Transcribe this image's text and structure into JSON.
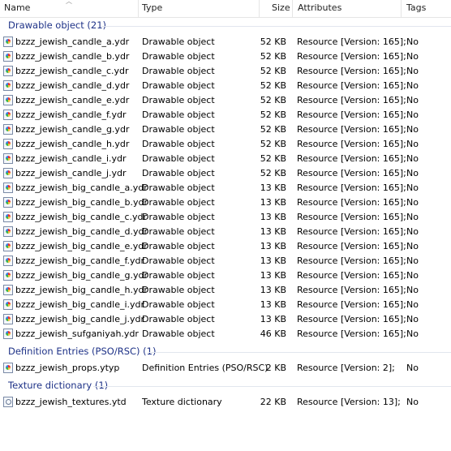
{
  "columns": {
    "name": "Name",
    "type": "Type",
    "size": "Size",
    "attributes": "Attributes",
    "tags": "Tags"
  },
  "groups": [
    {
      "label": "Drawable object (21)"
    },
    {
      "label": "Definition Entries (PSO/RSC) (1)"
    },
    {
      "label": "Texture dictionary (1)"
    }
  ],
  "files": [
    {
      "name": "bzzz_jewish_candle_a.ydr",
      "type": "Drawable object",
      "size": "52 KB",
      "attributes": "Resource [Version: 165];",
      "tags": "No"
    },
    {
      "name": "bzzz_jewish_candle_b.ydr",
      "type": "Drawable object",
      "size": "52 KB",
      "attributes": "Resource [Version: 165];",
      "tags": "No"
    },
    {
      "name": "bzzz_jewish_candle_c.ydr",
      "type": "Drawable object",
      "size": "52 KB",
      "attributes": "Resource [Version: 165];",
      "tags": "No"
    },
    {
      "name": "bzzz_jewish_candle_d.ydr",
      "type": "Drawable object",
      "size": "52 KB",
      "attributes": "Resource [Version: 165];",
      "tags": "No"
    },
    {
      "name": "bzzz_jewish_candle_e.ydr",
      "type": "Drawable object",
      "size": "52 KB",
      "attributes": "Resource [Version: 165];",
      "tags": "No"
    },
    {
      "name": "bzzz_jewish_candle_f.ydr",
      "type": "Drawable object",
      "size": "52 KB",
      "attributes": "Resource [Version: 165];",
      "tags": "No"
    },
    {
      "name": "bzzz_jewish_candle_g.ydr",
      "type": "Drawable object",
      "size": "52 KB",
      "attributes": "Resource [Version: 165];",
      "tags": "No"
    },
    {
      "name": "bzzz_jewish_candle_h.ydr",
      "type": "Drawable object",
      "size": "52 KB",
      "attributes": "Resource [Version: 165];",
      "tags": "No"
    },
    {
      "name": "bzzz_jewish_candle_i.ydr",
      "type": "Drawable object",
      "size": "52 KB",
      "attributes": "Resource [Version: 165];",
      "tags": "No"
    },
    {
      "name": "bzzz_jewish_candle_j.ydr",
      "type": "Drawable object",
      "size": "52 KB",
      "attributes": "Resource [Version: 165];",
      "tags": "No"
    },
    {
      "name": "bzzz_jewish_big_candle_a.ydr",
      "type": "Drawable object",
      "size": "13 KB",
      "attributes": "Resource [Version: 165];",
      "tags": "No"
    },
    {
      "name": "bzzz_jewish_big_candle_b.ydr",
      "type": "Drawable object",
      "size": "13 KB",
      "attributes": "Resource [Version: 165];",
      "tags": "No"
    },
    {
      "name": "bzzz_jewish_big_candle_c.ydr",
      "type": "Drawable object",
      "size": "13 KB",
      "attributes": "Resource [Version: 165];",
      "tags": "No"
    },
    {
      "name": "bzzz_jewish_big_candle_d.ydr",
      "type": "Drawable object",
      "size": "13 KB",
      "attributes": "Resource [Version: 165];",
      "tags": "No"
    },
    {
      "name": "bzzz_jewish_big_candle_e.ydr",
      "type": "Drawable object",
      "size": "13 KB",
      "attributes": "Resource [Version: 165];",
      "tags": "No"
    },
    {
      "name": "bzzz_jewish_big_candle_f.ydr",
      "type": "Drawable object",
      "size": "13 KB",
      "attributes": "Resource [Version: 165];",
      "tags": "No"
    },
    {
      "name": "bzzz_jewish_big_candle_g.ydr",
      "type": "Drawable object",
      "size": "13 KB",
      "attributes": "Resource [Version: 165];",
      "tags": "No"
    },
    {
      "name": "bzzz_jewish_big_candle_h.ydr",
      "type": "Drawable object",
      "size": "13 KB",
      "attributes": "Resource [Version: 165];",
      "tags": "No"
    },
    {
      "name": "bzzz_jewish_big_candle_i.ydr",
      "type": "Drawable object",
      "size": "13 KB",
      "attributes": "Resource [Version: 165];",
      "tags": "No"
    },
    {
      "name": "bzzz_jewish_big_candle_j.ydr",
      "type": "Drawable object",
      "size": "13 KB",
      "attributes": "Resource [Version: 165];",
      "tags": "No"
    },
    {
      "name": "bzzz_jewish_sufganiyah.ydr",
      "type": "Drawable object",
      "size": "46 KB",
      "attributes": "Resource [Version: 165];",
      "tags": "No"
    },
    {
      "name": "bzzz_jewish_props.ytyp",
      "type": "Definition Entries (PSO/RSC)",
      "size": "2 KB",
      "attributes": "Resource [Version: 2];",
      "tags": "No"
    },
    {
      "name": "bzzz_jewish_textures.ytd",
      "type": "Texture dictionary",
      "size": "22 KB",
      "attributes": "Resource [Version: 13];",
      "tags": "No"
    }
  ]
}
